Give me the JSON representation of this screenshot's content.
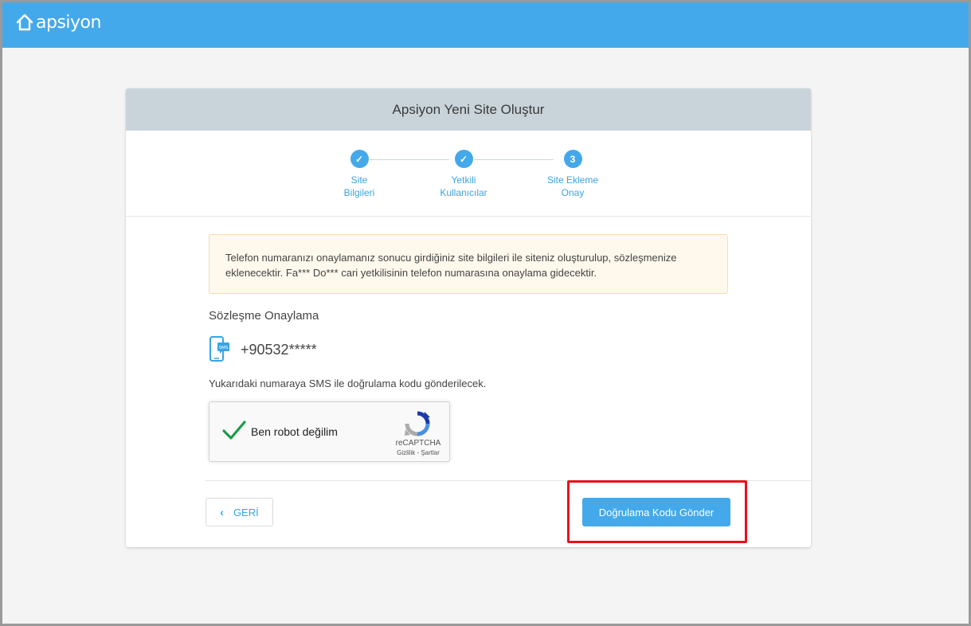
{
  "app": {
    "logo_text": "apsiyon",
    "brand_color": "#44a9ea"
  },
  "card": {
    "title": "Apsiyon Yeni Site Oluştur"
  },
  "steps": [
    {
      "label": "Site\nBilgileri",
      "status": "done",
      "marker": "✓"
    },
    {
      "label": "Yetkili\nKullanıcılar",
      "status": "done",
      "marker": "✓"
    },
    {
      "label": "Site Ekleme\nOnay",
      "status": "current",
      "marker": "3"
    }
  ],
  "alert": {
    "text": "Telefon numaranızı onaylamanız sonucu girdiğiniz site bilgileri ile siteniz oluşturulup, sözleşmenize eklenecektir. Fa*** Do*** cari yetkilisinin telefon numarasına onaylama gidecektir."
  },
  "verification": {
    "section_title": "Sözleşme Onaylama",
    "phone_icon": "sms-phone-icon",
    "phone_number": "+90532*****",
    "info": "Yukarıdaki numaraya SMS ile doğrulama kodu gönderilecek."
  },
  "captcha": {
    "label": "Ben robot değilim",
    "checked": true,
    "brand": "reCAPTCHA",
    "links": "Gizlilik - Şartlar"
  },
  "actions": {
    "back_label": "GERİ",
    "send_label": "Doğrulama Kodu Gönder"
  },
  "annotation": {
    "highlight_color": "#e8101a"
  }
}
